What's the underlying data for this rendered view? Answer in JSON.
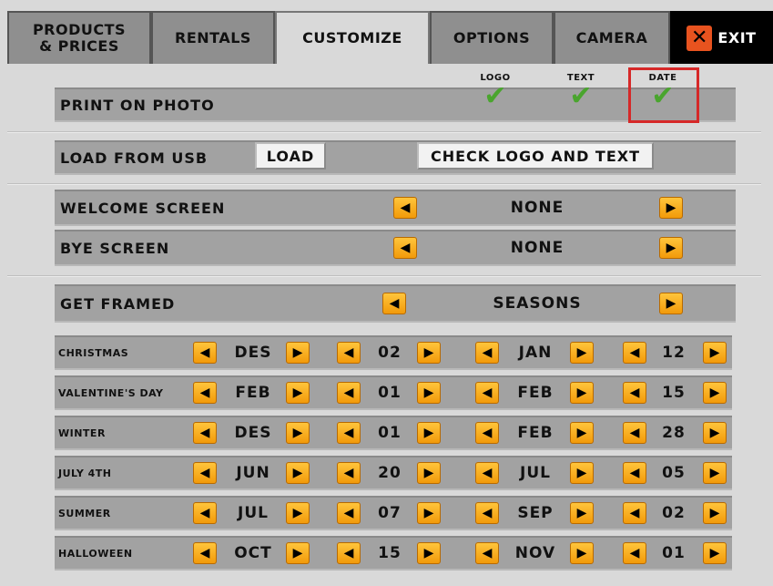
{
  "tabs": [
    {
      "label": "PRODUCTS\n& PRICES"
    },
    {
      "label": "RENTALS"
    },
    {
      "label": "CUSTOMIZE"
    },
    {
      "label": "OPTIONS"
    },
    {
      "label": "CAMERA"
    },
    {
      "label": "EXIT"
    }
  ],
  "print_on_photo": {
    "label": "PRINT ON PHOTO",
    "options": [
      {
        "label": "LOGO",
        "checked": true
      },
      {
        "label": "TEXT",
        "checked": true
      },
      {
        "label": "DATE",
        "checked": true
      }
    ]
  },
  "usb": {
    "label": "LOAD FROM USB",
    "load_button": "LOAD",
    "check_button": "CHECK LOGO AND TEXT"
  },
  "welcome": {
    "label": "WELCOME SCREEN",
    "value": "NONE"
  },
  "bye": {
    "label": "BYE SCREEN",
    "value": "NONE"
  },
  "framed": {
    "label": "GET FRAMED",
    "value": "SEASONS"
  },
  "seasons": [
    {
      "name": "CHRISTMAS",
      "start_month": "DES",
      "start_day": "02",
      "end_month": "JAN",
      "end_day": "12"
    },
    {
      "name": "VALENTINE'S DAY",
      "start_month": "FEB",
      "start_day": "01",
      "end_month": "FEB",
      "end_day": "15"
    },
    {
      "name": "WINTER",
      "start_month": "DES",
      "start_day": "01",
      "end_month": "FEB",
      "end_day": "28"
    },
    {
      "name": "JULY 4TH",
      "start_month": "JUN",
      "start_day": "20",
      "end_month": "JUL",
      "end_day": "05"
    },
    {
      "name": "SUMMER",
      "start_month": "JUL",
      "start_day": "07",
      "end_month": "SEP",
      "end_day": "02"
    },
    {
      "name": "HALLOWEEN",
      "start_month": "OCT",
      "start_day": "15",
      "end_month": "NOV",
      "end_day": "01"
    }
  ],
  "icons": {
    "left_arrow": "◀",
    "right_arrow": "▶",
    "check": "✔",
    "exit_x": "✕"
  },
  "colors": {
    "accent": "#f2a20f",
    "check": "#4aa52e",
    "highlight": "#d62828",
    "exit": "#e8531f"
  }
}
